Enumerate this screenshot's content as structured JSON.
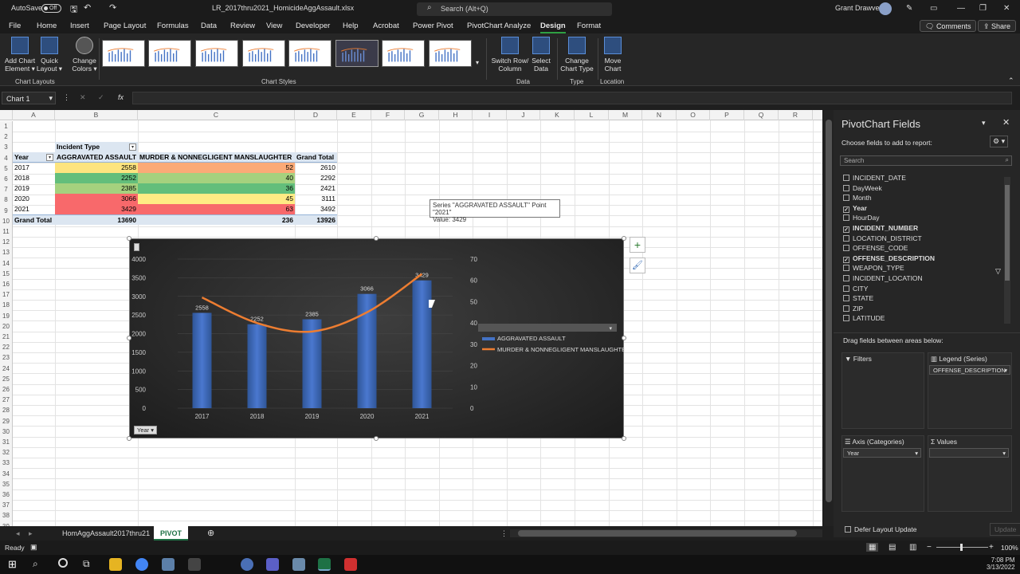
{
  "titlebar": {
    "autosave_label": "AutoSave",
    "autosave_state": "Off",
    "filename": "LR_2017thru2021_HomicideAggAssault.xlsx",
    "search_placeholder": "Search (Alt+Q)",
    "user": "Grant Drawve"
  },
  "menu": {
    "items": [
      "File",
      "Home",
      "Insert",
      "Page Layout",
      "Formulas",
      "Data",
      "Review",
      "View",
      "Developer",
      "Help",
      "Acrobat",
      "Power Pivot",
      "PivotChart Analyze",
      "Design",
      "Format"
    ],
    "active": "Design",
    "comments": "Comments",
    "share": "Share"
  },
  "ribbon": {
    "add_chart_element": "Add Chart Element",
    "quick_layout": "Quick Layout",
    "change_colors": "Change Colors",
    "switch_row_column": "Switch Row/ Column",
    "select_data": "Select Data",
    "change_chart_type": "Change Chart Type",
    "move_chart": "Move Chart",
    "groups": {
      "chart_layouts": "Chart Layouts",
      "chart_styles": "Chart Styles",
      "data": "Data",
      "type": "Type",
      "location": "Location"
    }
  },
  "formula_bar": {
    "name_box": "Chart 1",
    "fx": "fx"
  },
  "columns": [
    "A",
    "B",
    "C",
    "D",
    "E",
    "F",
    "G",
    "H",
    "I",
    "J",
    "K",
    "L",
    "M",
    "N",
    "O",
    "P",
    "Q",
    "R"
  ],
  "pivot": {
    "incident_type_label": "Incident Type",
    "year_label": "Year",
    "col_headers": [
      "AGGRAVATED ASSAULT",
      "MURDER & NONNEGLIGENT MANSLAUGHTER",
      "Grand Total"
    ],
    "rows": [
      {
        "year": "2017",
        "agg": "2558",
        "murder": "52",
        "total": "2610"
      },
      {
        "year": "2018",
        "agg": "2252",
        "murder": "40",
        "total": "2292"
      },
      {
        "year": "2019",
        "agg": "2385",
        "murder": "36",
        "total": "2421"
      },
      {
        "year": "2020",
        "agg": "3066",
        "murder": "45",
        "total": "3111"
      },
      {
        "year": "2021",
        "agg": "3429",
        "murder": "63",
        "total": "3492"
      }
    ],
    "grand_total": {
      "label": "Grand Total",
      "agg": "13690",
      "murder": "236",
      "total": "13926"
    },
    "colors": {
      "agg": [
        "#fde47f",
        "#63be7b",
        "#a5d17e",
        "#f8696b",
        "#f8696b"
      ],
      "murder": [
        "#fbaa77",
        "#a5d17e",
        "#63be7b",
        "#ffeb84",
        "#f8696b"
      ]
    }
  },
  "chart_data": {
    "type": "bar",
    "categories": [
      "2017",
      "2018",
      "2019",
      "2020",
      "2021"
    ],
    "series": [
      {
        "name": "AGGRAVATED ASSAULT",
        "values": [
          2558,
          2252,
          2385,
          3066,
          3429
        ],
        "axis": "left",
        "kind": "bar",
        "color": "#4472c4"
      },
      {
        "name": "MURDER & NONNEGLIGENT MANSLAUGHTER",
        "values": [
          52,
          40,
          36,
          45,
          63
        ],
        "axis": "right",
        "kind": "line",
        "color": "#ed7d31"
      }
    ],
    "ylim_left": [
      0,
      4000
    ],
    "yticks_left": [
      "0",
      "500",
      "1000",
      "1500",
      "2000",
      "2500",
      "3000",
      "3500",
      "4000"
    ],
    "ylim_right": [
      0,
      70
    ],
    "yticks_right": [
      "0",
      "10",
      "20",
      "30",
      "40",
      "50",
      "60",
      "70"
    ],
    "data_labels": [
      "2558",
      "2252",
      "2385",
      "3066",
      "3429"
    ],
    "axis_button": "Year",
    "legend_position": "right",
    "tooltip_line1": "Series \"AGGRAVATED ASSAULT\" Point \"2021\"",
    "tooltip_line2": "Value: 3429"
  },
  "pivot_fields": {
    "title": "PivotChart Fields",
    "subtitle": "Choose fields to add to report:",
    "search_placeholder": "Search",
    "fields": [
      {
        "name": "INCIDENT_DATE",
        "checked": false
      },
      {
        "name": "DayWeek",
        "checked": false
      },
      {
        "name": "Month",
        "checked": false
      },
      {
        "name": "Year",
        "checked": true
      },
      {
        "name": "HourDay",
        "checked": false
      },
      {
        "name": "INCIDENT_NUMBER",
        "checked": true
      },
      {
        "name": "LOCATION_DISTRICT",
        "checked": false
      },
      {
        "name": "OFFENSE_CODE",
        "checked": false
      },
      {
        "name": "OFFENSE_DESCRIPTION",
        "checked": true
      },
      {
        "name": "WEAPON_TYPE",
        "checked": false
      },
      {
        "name": "INCIDENT_LOCATION",
        "checked": false
      },
      {
        "name": "CITY",
        "checked": false
      },
      {
        "name": "STATE",
        "checked": false
      },
      {
        "name": "ZIP",
        "checked": false
      },
      {
        "name": "LATITUDE",
        "checked": false
      }
    ],
    "drag_label": "Drag fields between areas below:",
    "filters": "Filters",
    "legend_series": "Legend (Series)",
    "legend_value": "OFFENSE_DESCRIPTION",
    "axis_categories": "Axis (Categories)",
    "axis_value": "Year",
    "values": "Values",
    "defer": "Defer Layout Update",
    "update": "Update"
  },
  "tabs": {
    "sheet1": "HomAggAssault2017thru21",
    "sheet2": "PIVOT"
  },
  "status": {
    "ready": "Ready",
    "zoom": "100%"
  },
  "taskbar": {
    "time": "7:08 PM",
    "date": "3/13/2022"
  }
}
